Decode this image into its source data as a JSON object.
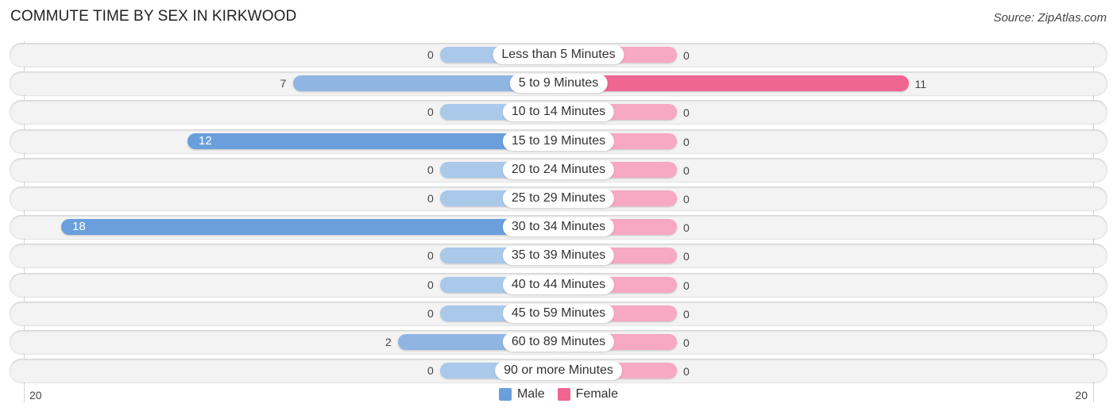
{
  "header": {
    "title": "COMMUTE TIME BY SEX IN KIRKWOOD",
    "source": "Source: ZipAtlas.com"
  },
  "colors": {
    "male_strong": "#6a9fdc",
    "male_light": "#a9c8ea",
    "female_strong": "#f06693",
    "female_light": "#f7a8c2"
  },
  "chart_data": {
    "type": "bar",
    "orientation": "horizontal-diverging",
    "title": "COMMUTE TIME BY SEX IN KIRKWOOD",
    "categories": [
      "Less than 5 Minutes",
      "5 to 9 Minutes",
      "10 to 14 Minutes",
      "15 to 19 Minutes",
      "20 to 24 Minutes",
      "25 to 29 Minutes",
      "30 to 34 Minutes",
      "35 to 39 Minutes",
      "40 to 44 Minutes",
      "45 to 59 Minutes",
      "60 to 89 Minutes",
      "90 or more Minutes"
    ],
    "series": [
      {
        "name": "Male",
        "values": [
          0,
          7,
          0,
          12,
          0,
          0,
          18,
          0,
          0,
          0,
          2,
          0
        ]
      },
      {
        "name": "Female",
        "values": [
          0,
          11,
          0,
          0,
          0,
          0,
          0,
          0,
          0,
          0,
          0,
          0
        ]
      }
    ],
    "axis": {
      "left_label": "20",
      "right_label": "20",
      "max": 20
    },
    "legend": {
      "position": "bottom-center",
      "entries": [
        "Male",
        "Female"
      ]
    },
    "grid": false
  }
}
